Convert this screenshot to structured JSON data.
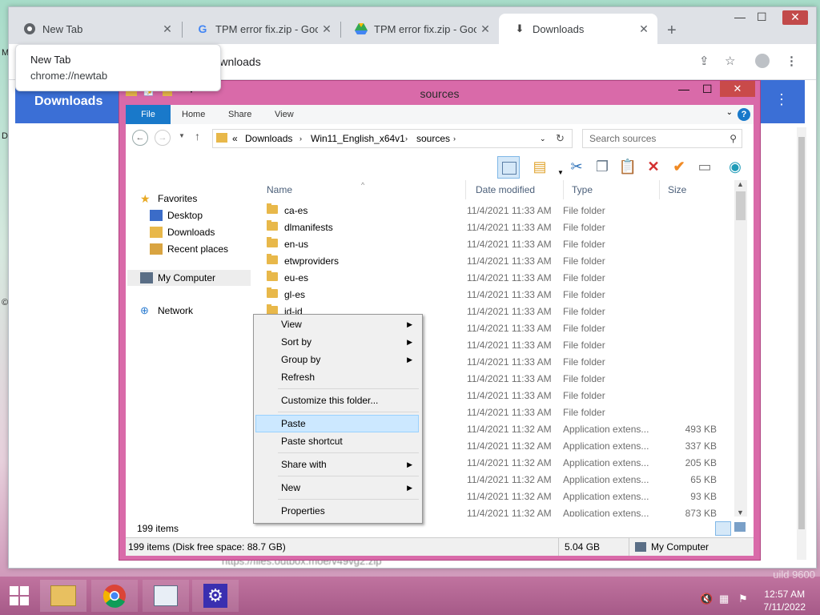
{
  "chrome": {
    "tabs": [
      {
        "title": "New Tab",
        "icon": "chrome-icon",
        "active": false
      },
      {
        "title": "TPM error fix.zip - Google",
        "icon": "google-icon",
        "active": false
      },
      {
        "title": "TPM error fix.zip - Google",
        "icon": "google-drive-icon",
        "active": false
      },
      {
        "title": "Downloads",
        "icon": "download-icon",
        "active": true
      }
    ],
    "address_text": "//downloads",
    "page_header": "Downloads",
    "tooltip": {
      "title": "New Tab",
      "url": "chrome://newtab"
    },
    "obscured_link": "https://files.outbox.moe/v49vg2.zip"
  },
  "explorer": {
    "title": "sources",
    "ribbon_tabs": [
      "File",
      "Home",
      "Share",
      "View"
    ],
    "breadcrumb": [
      "«",
      "Downloads",
      "Win11_English_x64v1",
      "sources"
    ],
    "search_placeholder": "Search sources",
    "nav": {
      "favorites": "Favorites",
      "desktop": "Desktop",
      "downloads": "Downloads",
      "recent": "Recent places",
      "computer": "My Computer",
      "network": "Network"
    },
    "columns": {
      "name": "Name",
      "date": "Date modified",
      "type": "Type",
      "size": "Size"
    },
    "files": [
      {
        "name": "ca-es",
        "date": "11/4/2021 11:33 AM",
        "type": "File folder",
        "size": "",
        "kind": "folder"
      },
      {
        "name": "dlmanifests",
        "date": "11/4/2021 11:33 AM",
        "type": "File folder",
        "size": "",
        "kind": "folder"
      },
      {
        "name": "en-us",
        "date": "11/4/2021 11:33 AM",
        "type": "File folder",
        "size": "",
        "kind": "folder"
      },
      {
        "name": "etwproviders",
        "date": "11/4/2021 11:33 AM",
        "type": "File folder",
        "size": "",
        "kind": "folder"
      },
      {
        "name": "eu-es",
        "date": "11/4/2021 11:33 AM",
        "type": "File folder",
        "size": "",
        "kind": "folder"
      },
      {
        "name": "gl-es",
        "date": "11/4/2021 11:33 AM",
        "type": "File folder",
        "size": "",
        "kind": "folder"
      },
      {
        "name": "id-id",
        "date": "11/4/2021 11:33 AM",
        "type": "File folder",
        "size": "",
        "kind": "folder"
      },
      {
        "name": "",
        "date": "11/4/2021 11:33 AM",
        "type": "File folder",
        "size": "",
        "kind": "folder"
      },
      {
        "name": "",
        "date": "11/4/2021 11:33 AM",
        "type": "File folder",
        "size": "",
        "kind": "folder"
      },
      {
        "name": "",
        "date": "11/4/2021 11:33 AM",
        "type": "File folder",
        "size": "",
        "kind": "folder"
      },
      {
        "name": "",
        "date": "11/4/2021 11:33 AM",
        "type": "File folder",
        "size": "",
        "kind": "folder"
      },
      {
        "name": "",
        "date": "11/4/2021 11:33 AM",
        "type": "File folder",
        "size": "",
        "kind": "folder"
      },
      {
        "name": "",
        "date": "11/4/2021 11:33 AM",
        "type": "File folder",
        "size": "",
        "kind": "folder"
      },
      {
        "name": "",
        "date": "11/4/2021 11:32 AM",
        "type": "Application extens...",
        "size": "493 KB",
        "kind": "app"
      },
      {
        "name": "",
        "date": "11/4/2021 11:32 AM",
        "type": "Application extens...",
        "size": "337 KB",
        "kind": "app"
      },
      {
        "name": "",
        "date": "11/4/2021 11:32 AM",
        "type": "Application extens...",
        "size": "205 KB",
        "kind": "app"
      },
      {
        "name": "",
        "date": "11/4/2021 11:32 AM",
        "type": "Application extens...",
        "size": "65 KB",
        "kind": "app"
      },
      {
        "name": "",
        "date": "11/4/2021 11:32 AM",
        "type": "Application extens...",
        "size": "93 KB",
        "kind": "app"
      },
      {
        "name": "",
        "date": "11/4/2021 11:32 AM",
        "type": "Application extens...",
        "size": "873 KB",
        "kind": "app"
      }
    ],
    "item_count": "199 items",
    "status_left": "199 items (Disk free space: 88.7 GB)",
    "status_size": "5.04 GB",
    "status_location": "My Computer"
  },
  "context_menu": {
    "items": [
      {
        "label": "View",
        "submenu": true
      },
      {
        "label": "Sort by",
        "submenu": true
      },
      {
        "label": "Group by",
        "submenu": true
      },
      {
        "label": "Refresh",
        "submenu": false
      },
      {
        "label": "Customize this folder...",
        "submenu": false
      },
      {
        "label": "Paste",
        "submenu": false,
        "highlighted": true
      },
      {
        "label": "Paste shortcut",
        "submenu": false
      },
      {
        "label": "Share with",
        "submenu": true
      },
      {
        "label": "New",
        "submenu": true
      },
      {
        "label": "Properties",
        "submenu": false
      }
    ]
  },
  "taskbar": {
    "time": "12:57 AM",
    "date": "7/11/2022",
    "desktop_text": "uild 9600"
  },
  "colors": {
    "explorer_frame": "#d96aa9",
    "chrome_header": "#3b6fd6",
    "taskbar": "#b0669a",
    "file_tab": "#1979ca"
  }
}
